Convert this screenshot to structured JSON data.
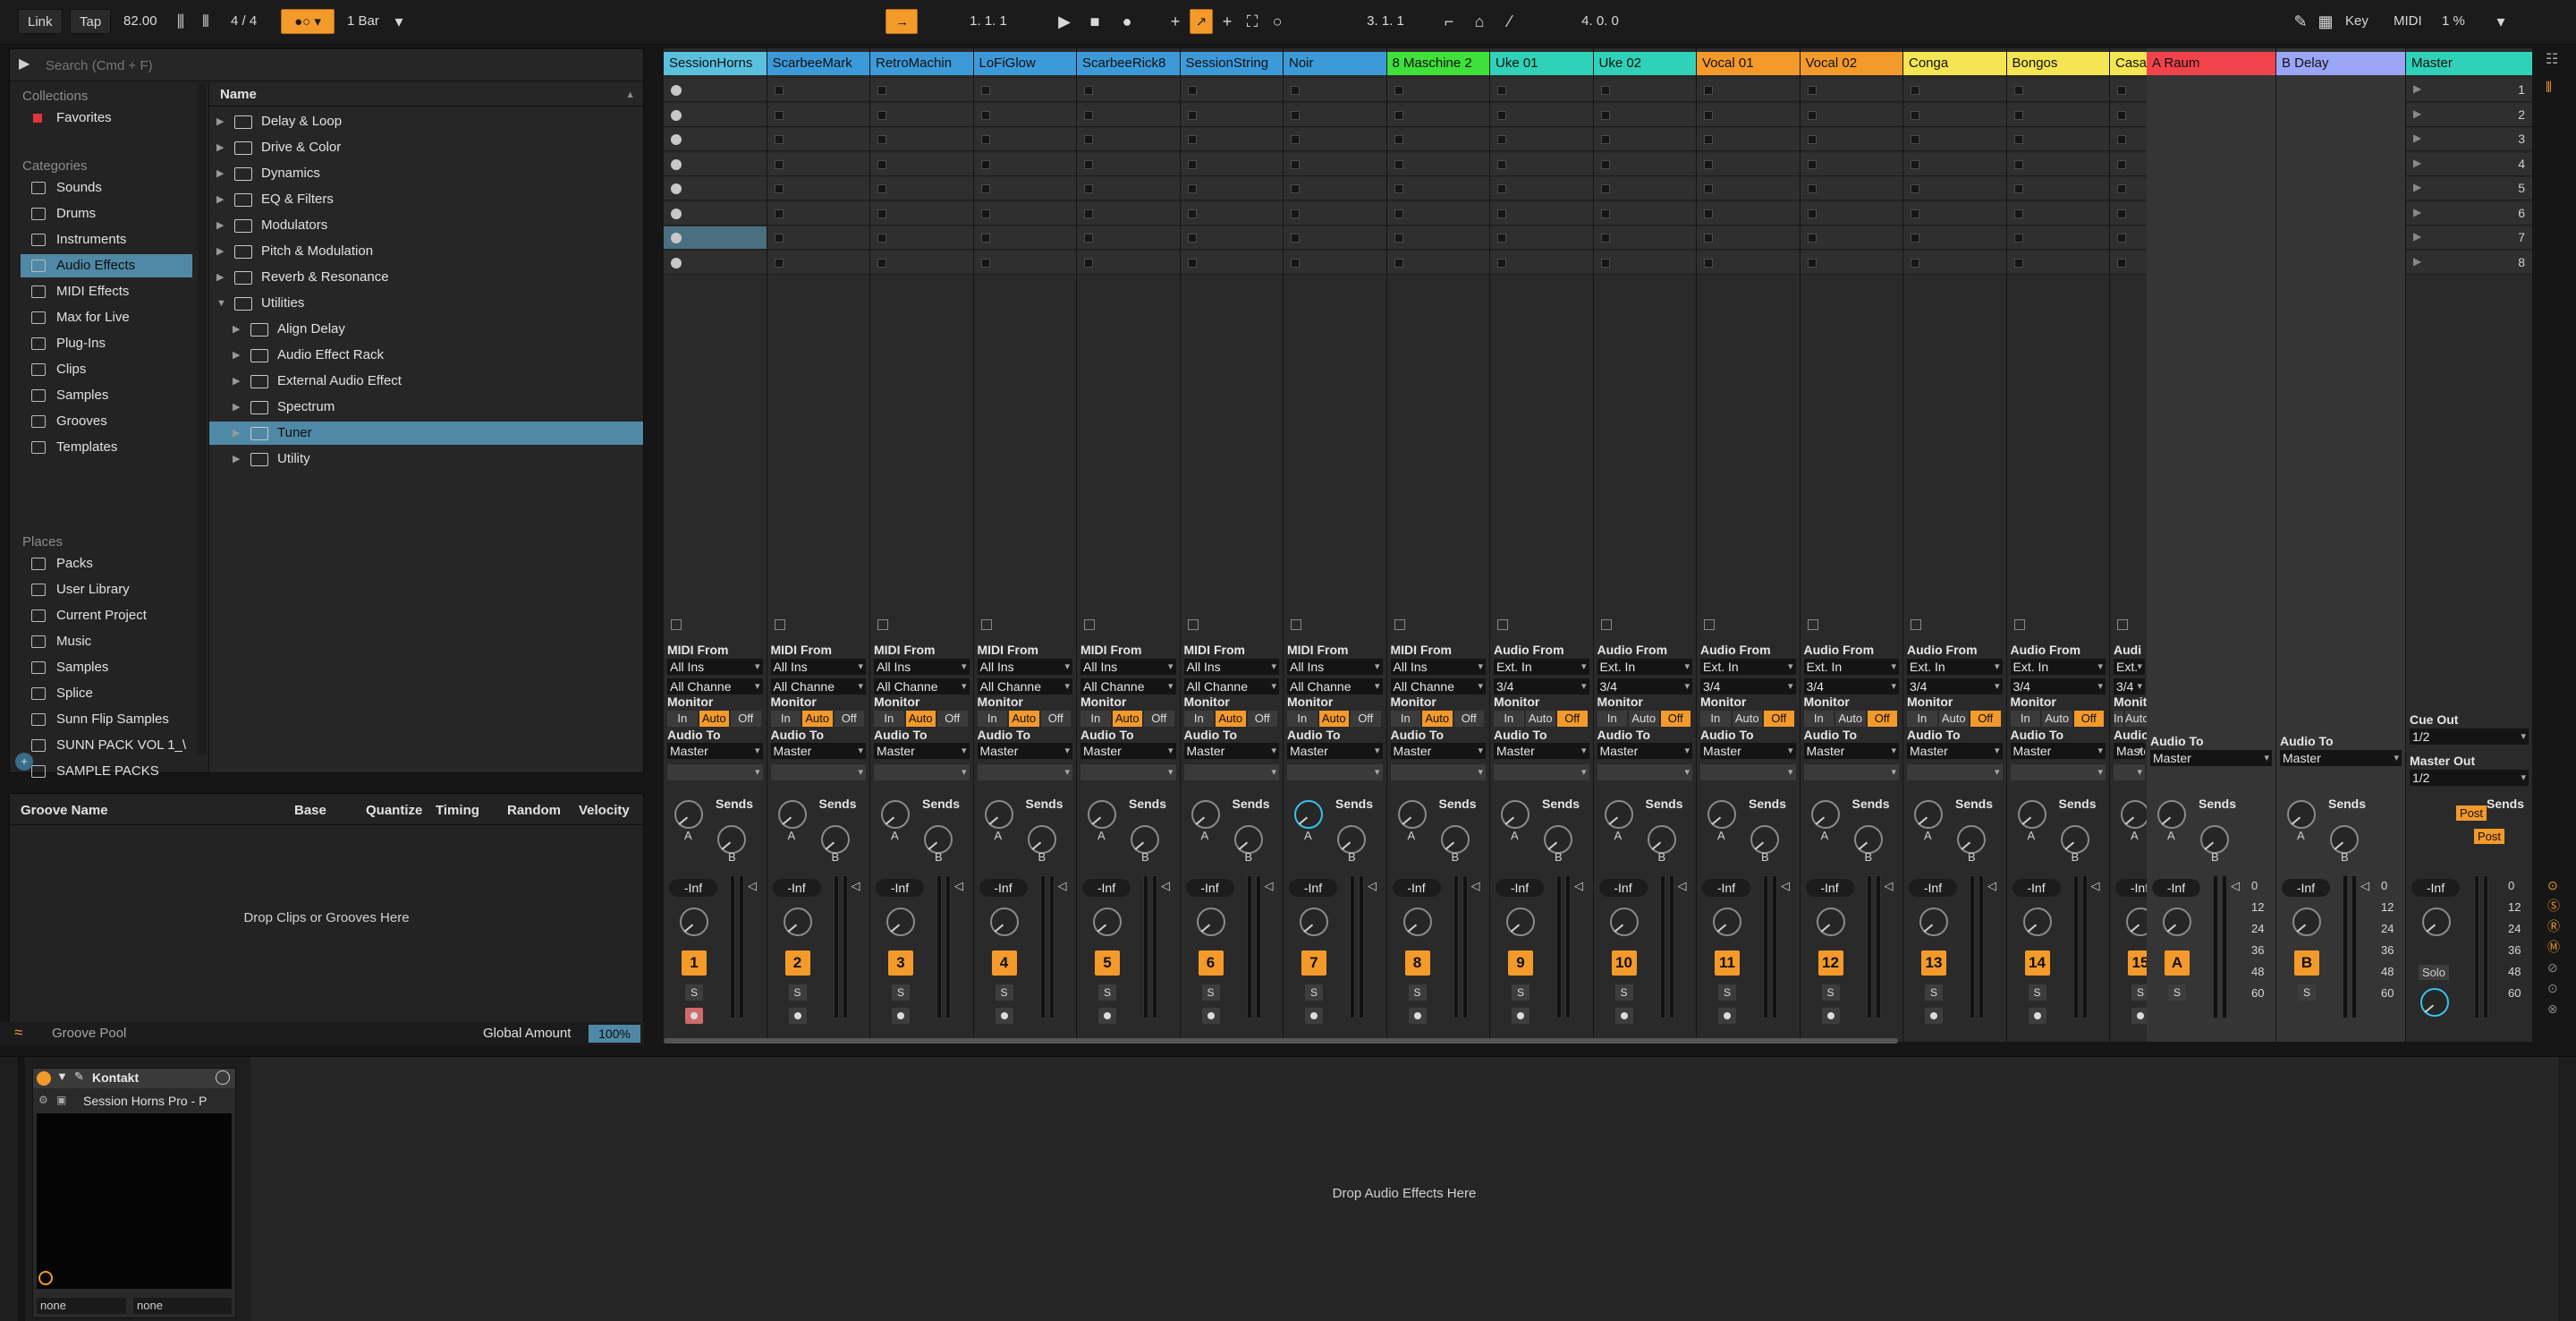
{
  "transport": {
    "link": "Link",
    "tap": "Tap",
    "tempo": "82.00",
    "meter": "4 / 4",
    "quantize": "1 Bar",
    "position": "1.  1.  1",
    "loop_start": "3.  1.  1",
    "loop_length": "4.  0.  0",
    "key": "Key",
    "midi": "MIDI",
    "cpu": "1 %"
  },
  "browser": {
    "search_placeholder": "Search (Cmd + F)",
    "collections_title": "Collections",
    "favorites": "Favorites",
    "categories_title": "Categories",
    "categories": [
      "Sounds",
      "Drums",
      "Instruments",
      "Audio Effects",
      "MIDI Effects",
      "Max for Live",
      "Plug-Ins",
      "Clips",
      "Samples",
      "Grooves",
      "Templates"
    ],
    "places_title": "Places",
    "places": [
      "Packs",
      "User Library",
      "Current Project",
      "Music",
      "Samples",
      "Splice",
      "Sunn Flip Samples",
      "SUNN PACK VOL 1_\\",
      "SAMPLE PACKS"
    ],
    "name_header": "Name",
    "items": [
      "Delay & Loop",
      "Drive & Color",
      "Dynamics",
      "EQ & Filters",
      "Modulators",
      "Pitch & Modulation",
      "Reverb & Resonance",
      "Utilities"
    ],
    "utilities": [
      "Align Delay",
      "Audio Effect Rack",
      "External Audio Effect",
      "Spectrum",
      "Tuner",
      "Utility"
    ]
  },
  "groove": {
    "headers": [
      "Groove Name",
      "Base",
      "Quantize",
      "Timing",
      "Random",
      "Velocity"
    ],
    "drop_text": "Drop Clips or Grooves Here",
    "pool": "Groove Pool",
    "global_amount_label": "Global Amount",
    "global_amount": "100%"
  },
  "tracks": [
    {
      "name": "SessionHorns",
      "color": "#5bc0de",
      "from_label": "MIDI From",
      "from": "All Ins",
      "ch": "All Channe",
      "mon": "auto",
      "num": "1"
    },
    {
      "name": "ScarbeeMark",
      "color": "#3d9ad8",
      "from_label": "MIDI From",
      "from": "All Ins",
      "ch": "All Channe",
      "mon": "auto",
      "num": "2"
    },
    {
      "name": "RetroMachin",
      "color": "#3d9ad8",
      "from_label": "MIDI From",
      "from": "All Ins",
      "ch": "All Channe",
      "mon": "auto",
      "num": "3"
    },
    {
      "name": "LoFiGlow",
      "color": "#3d9ad8",
      "from_label": "MIDI From",
      "from": "All Ins",
      "ch": "All Channe",
      "mon": "auto",
      "num": "4"
    },
    {
      "name": "ScarbeeRick8",
      "color": "#3d9ad8",
      "from_label": "MIDI From",
      "from": "All Ins",
      "ch": "All Channe",
      "mon": "auto",
      "num": "5"
    },
    {
      "name": "SessionString",
      "color": "#3d9ad8",
      "from_label": "MIDI From",
      "from": "All Ins",
      "ch": "All Channe",
      "mon": "auto",
      "num": "6"
    },
    {
      "name": "Noir",
      "color": "#3d9ad8",
      "from_label": "MIDI From",
      "from": "All Ins",
      "ch": "All Channe",
      "mon": "auto",
      "num": "7"
    },
    {
      "name": "8 Maschine 2",
      "color": "#3fe03a",
      "from_label": "MIDI From",
      "from": "All Ins",
      "ch": "All Channe",
      "mon": "auto",
      "num": "8"
    },
    {
      "name": "Uke  01",
      "color": "#2fd2b8",
      "from_label": "Audio From",
      "from": "Ext. In",
      "ch": "3/4",
      "mon": "off",
      "num": "9"
    },
    {
      "name": "Uke  02",
      "color": "#2fd2b8",
      "from_label": "Audio From",
      "from": "Ext. In",
      "ch": "3/4",
      "mon": "off",
      "num": "10"
    },
    {
      "name": "Vocal  01",
      "color": "#f39a2b",
      "from_label": "Audio From",
      "from": "Ext. In",
      "ch": "3/4",
      "mon": "off",
      "num": "11"
    },
    {
      "name": "Vocal  02",
      "color": "#f39a2b",
      "from_label": "Audio From",
      "from": "Ext. In",
      "ch": "3/4",
      "mon": "off",
      "num": "12"
    },
    {
      "name": "Conga",
      "color": "#f4e552",
      "from_label": "Audio From",
      "from": "Ext. In",
      "ch": "3/4",
      "mon": "off",
      "num": "13"
    },
    {
      "name": "Bongos",
      "color": "#f4e552",
      "from_label": "Audio From",
      "from": "Ext. In",
      "ch": "3/4",
      "mon": "off",
      "num": "14"
    },
    {
      "name": "Casa",
      "color": "#f4e552",
      "from_label": "Audi",
      "from": "Ext.",
      "ch": "3/4",
      "mon": "off",
      "num": "15"
    }
  ],
  "monitor_label": "Monitor",
  "audio_to_label": "Audio To",
  "audio_to": "Master",
  "mon_opts": [
    "In",
    "Auto",
    "Off"
  ],
  "sends_label": "Sends",
  "vol": "-Inf",
  "returns": [
    {
      "name": "A Raum",
      "color": "#f0434b",
      "letter": "A"
    },
    {
      "name": "B Delay",
      "color": "#9aa6f5",
      "letter": "B"
    }
  ],
  "master": {
    "name": "Master",
    "color": "#2fd2b8",
    "cue_out_label": "Cue Out",
    "cue_out": "1/2",
    "master_out_label": "Master Out",
    "master_out": "1/2",
    "post": "Post",
    "solo": "Solo"
  },
  "scene_numbers": [
    "1",
    "2",
    "3",
    "4",
    "5",
    "6",
    "7",
    "8"
  ],
  "meter_scale": [
    "0",
    "12",
    "24",
    "36",
    "48",
    "60"
  ],
  "device": {
    "name": "Kontakt",
    "preset": "Session Horns Pro - P",
    "out_left": "none",
    "out_right": "none",
    "drop_text": "Drop Audio Effects Here"
  }
}
